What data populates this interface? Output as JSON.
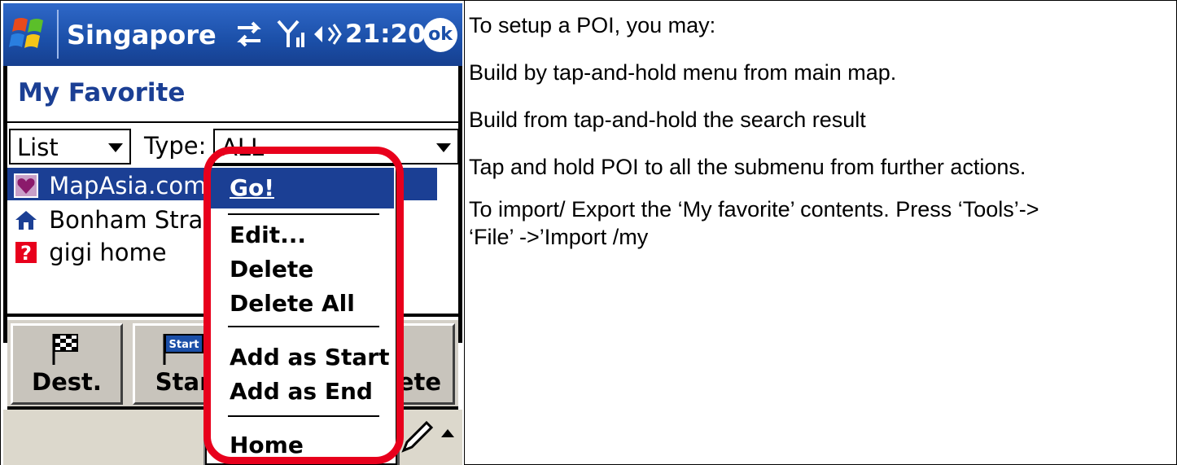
{
  "pda": {
    "title": "Singapore",
    "clock": "21:20",
    "ok_label": "ok",
    "heading": "My Favorite",
    "view_combo": "List",
    "type_label": "Type:",
    "type_combo": "ALL",
    "list_items": [
      {
        "label": "MapAsia.com",
        "icon": "heart-icon",
        "selected": true
      },
      {
        "label": "Bonham Strand",
        "icon": "house-icon",
        "selected": false
      },
      {
        "label": "gigi home",
        "icon": "question-icon",
        "selected": false
      }
    ],
    "toolbar": {
      "dest_label": "Dest.",
      "start_label": "Start",
      "start_badge": "Start",
      "delete_label": "ete"
    },
    "menu": {
      "go": "Go!",
      "edit": "Edit...",
      "delete": "Delete",
      "delete_all": "Delete All",
      "add_start": "Add as Start",
      "add_end": "Add as End",
      "home": "Home"
    },
    "colors": {
      "titlebar": "#1b4fa8",
      "selection": "#1b3f94",
      "highlight_ring": "#e8001c"
    }
  },
  "description": {
    "lines": [
      "To setup a POI, you may:",
      "Build by tap-and-hold menu from main map.",
      "Build from tap-and-hold the search result",
      "Tap and hold POI to all the submenu from further actions.",
      "To import/ Export the ‘My favorite’ contents. Press ‘Tools’->",
      "‘File’ ->’Import /my"
    ]
  }
}
